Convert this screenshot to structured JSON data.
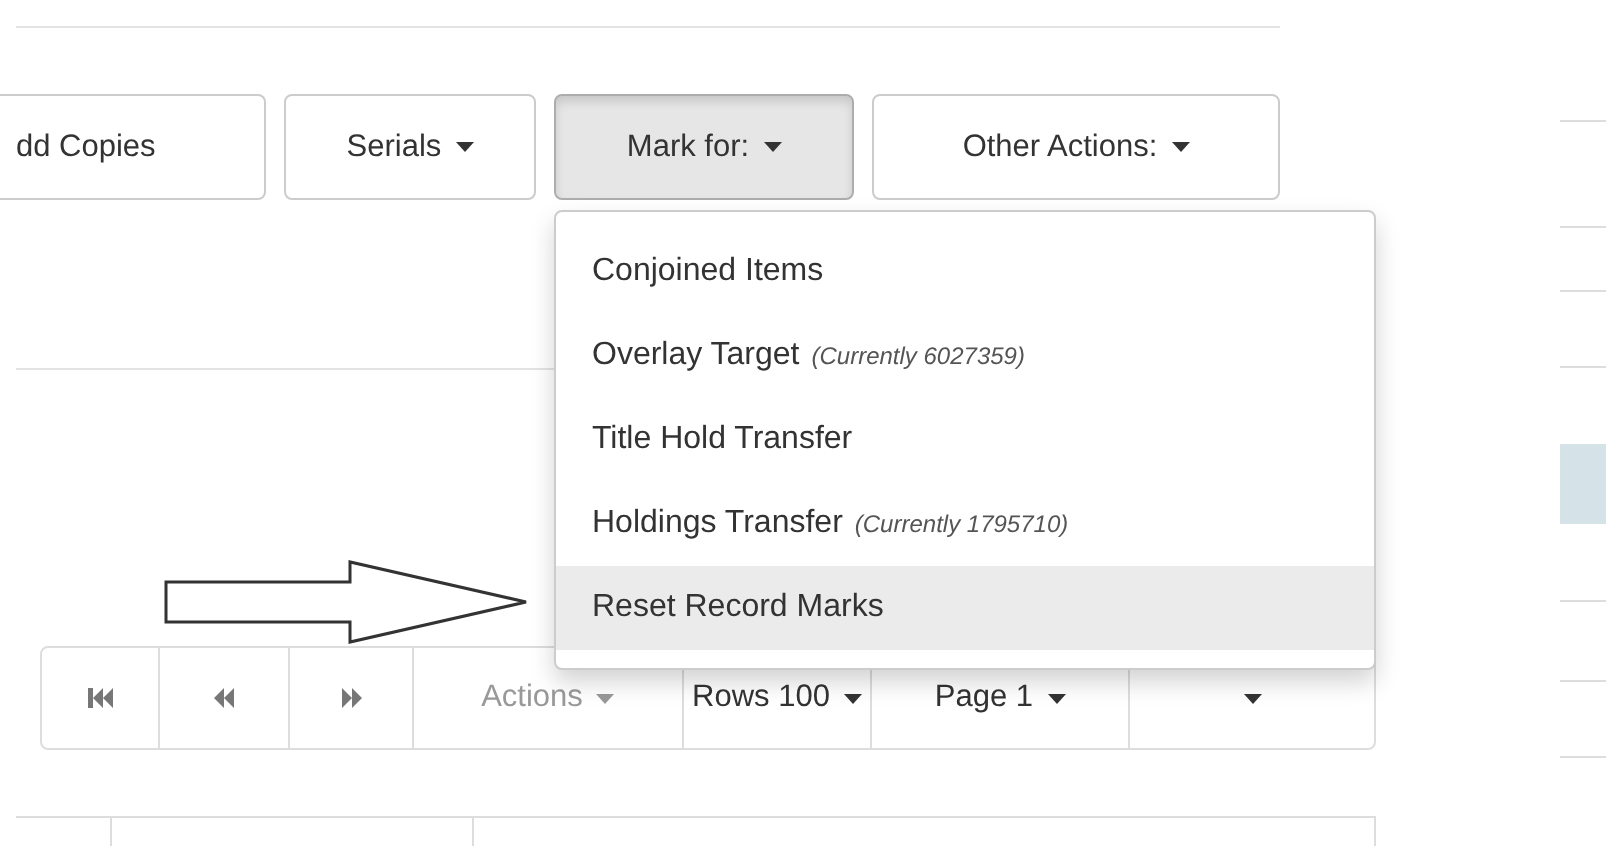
{
  "toolbar": {
    "buttons": [
      {
        "label": "dd Copies",
        "caret": false,
        "active": false
      },
      {
        "label": "Serials",
        "caret": true,
        "active": false
      },
      {
        "label": "Mark for:",
        "caret": true,
        "active": true
      },
      {
        "label": "Other Actions:",
        "caret": true,
        "active": false
      }
    ]
  },
  "dropdown": {
    "items": [
      {
        "label": "Conjoined Items",
        "highlighted": false
      },
      {
        "label": "Overlay Target",
        "note": "(Currently 6027359)",
        "highlighted": false
      },
      {
        "label": "Title Hold Transfer",
        "highlighted": false
      },
      {
        "label": "Holdings Transfer",
        "note": "(Currently 1795710)",
        "highlighted": false
      },
      {
        "label": "Reset Record Marks",
        "highlighted": true
      }
    ]
  },
  "pager": {
    "buttons": [
      {
        "kind": "first",
        "disabled": false
      },
      {
        "kind": "prev",
        "disabled": false
      },
      {
        "kind": "next",
        "disabled": false
      },
      {
        "kind": "menu",
        "label": "Actions",
        "disabled": true
      },
      {
        "kind": "menu",
        "label": "Rows 100",
        "disabled": false
      },
      {
        "kind": "menu",
        "label": "Page 1",
        "disabled": false
      },
      {
        "kind": "caret",
        "disabled": false
      }
    ]
  }
}
